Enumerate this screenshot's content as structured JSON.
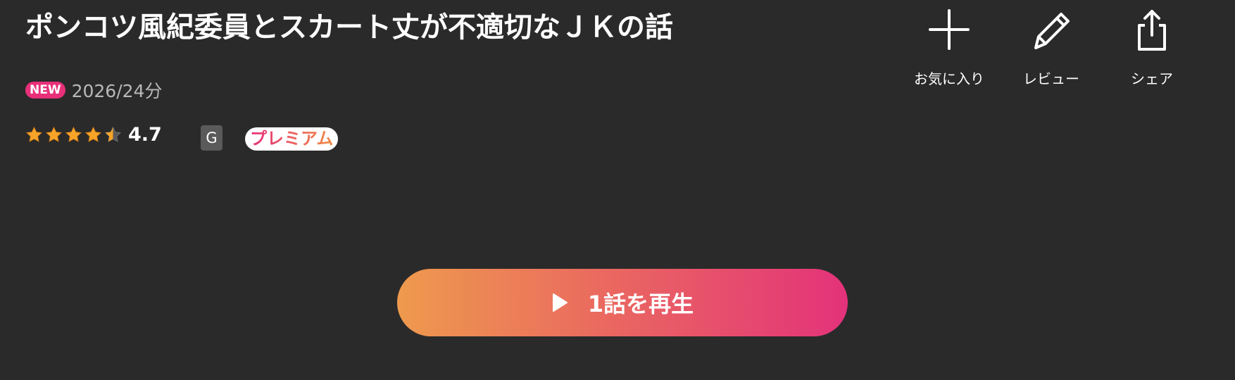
{
  "title": "ポンコツ風紀委員とスカート丈が不適切なＪＫの話",
  "meta": {
    "new_badge": "NEW",
    "info": "2026/24分"
  },
  "rating": {
    "value": "4.7",
    "stars": 4.5,
    "star_color": "#f7a428"
  },
  "age_rating": "G",
  "premium_label": "プレミアム",
  "actions": {
    "favorite_label": "お気に入り",
    "review_label": "レビュー",
    "share_label": "シェア"
  },
  "play_button": {
    "label": "1話を再生",
    "gradient_start": "#ee9a4e",
    "gradient_end": "#e3327a"
  },
  "colors": {
    "background": "#2a2a2a",
    "new_badge": "#e8307a",
    "age_badge": "#5a5a5a"
  }
}
